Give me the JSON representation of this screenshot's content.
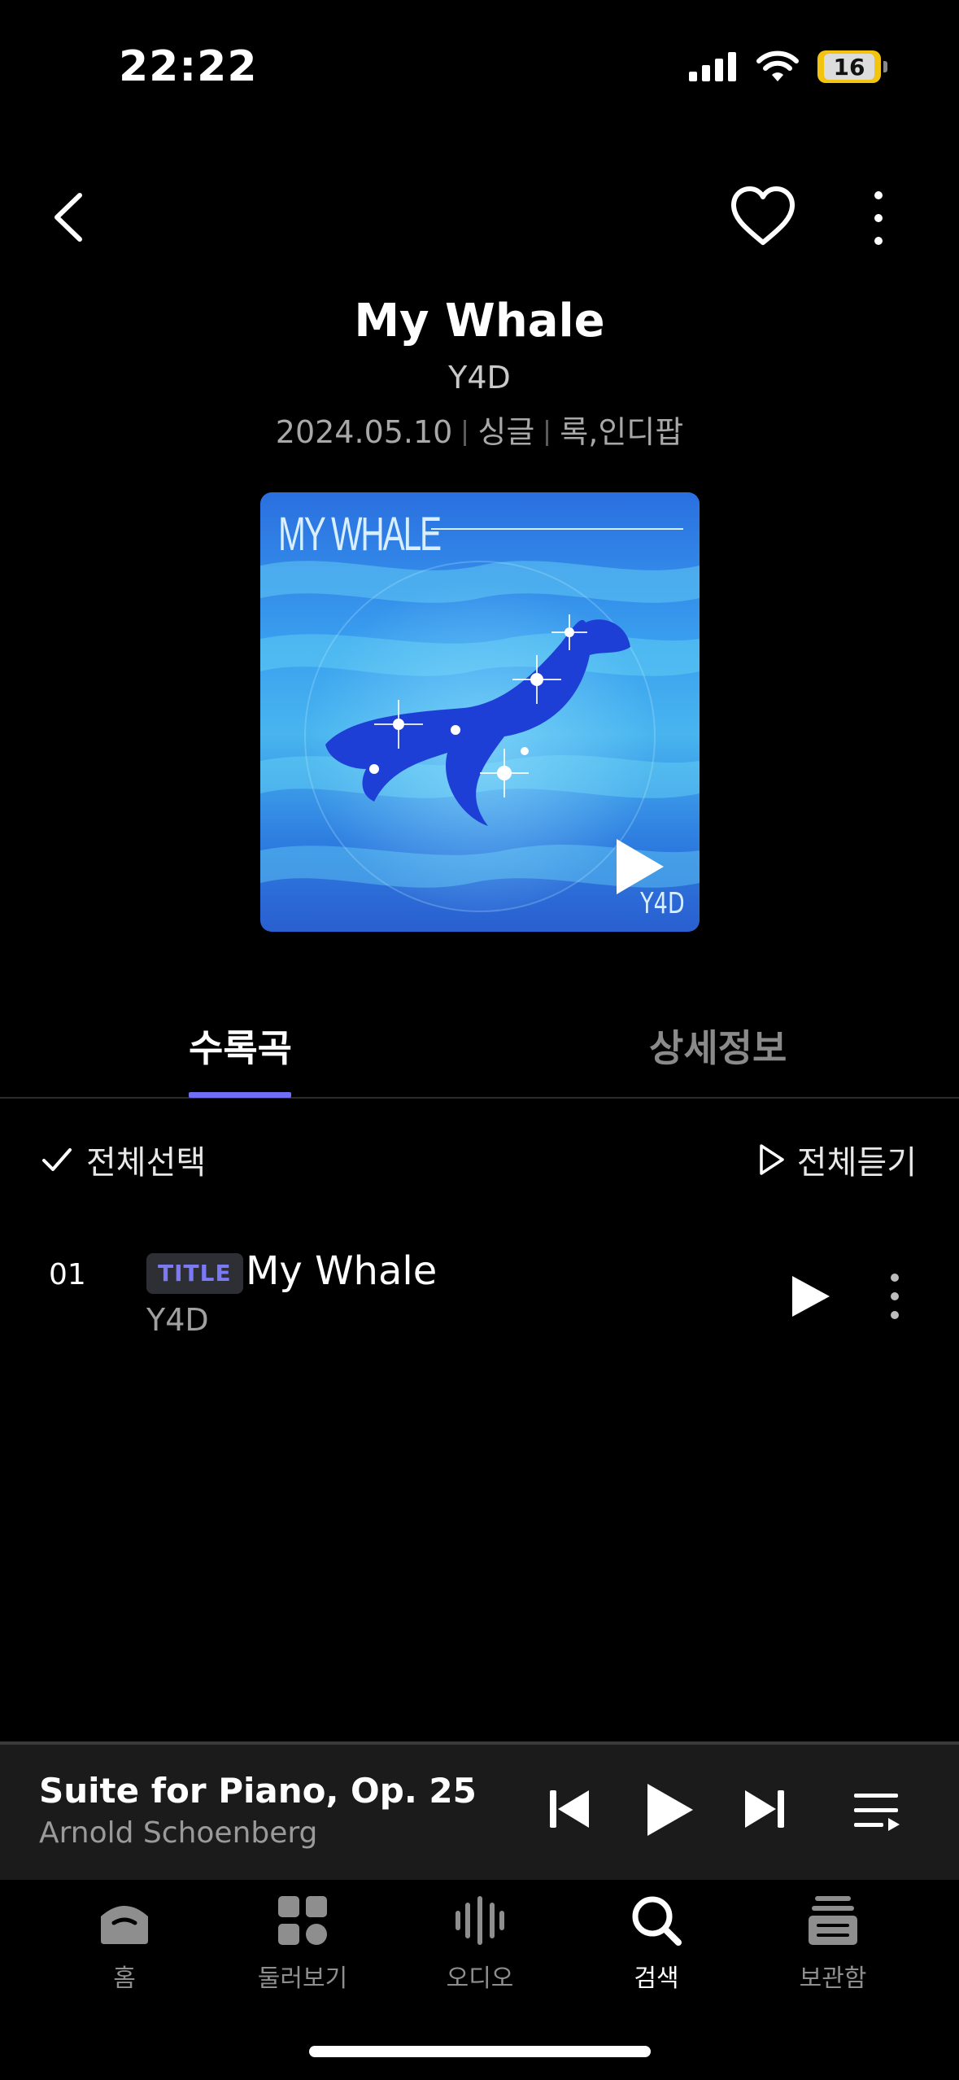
{
  "status_bar": {
    "time": "22:22",
    "battery": "16"
  },
  "album": {
    "title": "My Whale",
    "artist": "Y4D",
    "date": "2024.05.10",
    "type": "싱글",
    "genre": "록,인디팝",
    "cover_text": "MY WHALE",
    "cover_logo": "Y4D"
  },
  "tabs": {
    "tracks": "수록곡",
    "details": "상세정보",
    "active": "tracks"
  },
  "actions": {
    "select_all": "전체선택",
    "listen_all": "전체듣기"
  },
  "tracks": [
    {
      "number": "01",
      "badge": "TITLE",
      "title": "My Whale",
      "artist": "Y4D"
    }
  ],
  "mini_player": {
    "title": "Suite for Piano, Op. 25",
    "artist": "Arnold Schoenberg"
  },
  "bottom_nav": [
    {
      "label": "홈",
      "icon": "home-icon"
    },
    {
      "label": "둘러보기",
      "icon": "browse-icon"
    },
    {
      "label": "오디오",
      "icon": "audio-icon"
    },
    {
      "label": "검색",
      "icon": "search-icon",
      "active": true
    },
    {
      "label": "보관함",
      "icon": "library-icon"
    }
  ],
  "colors": {
    "accent": "#6f6ef5",
    "background": "#000000",
    "mini_player_bg": "#1b1b1b"
  }
}
